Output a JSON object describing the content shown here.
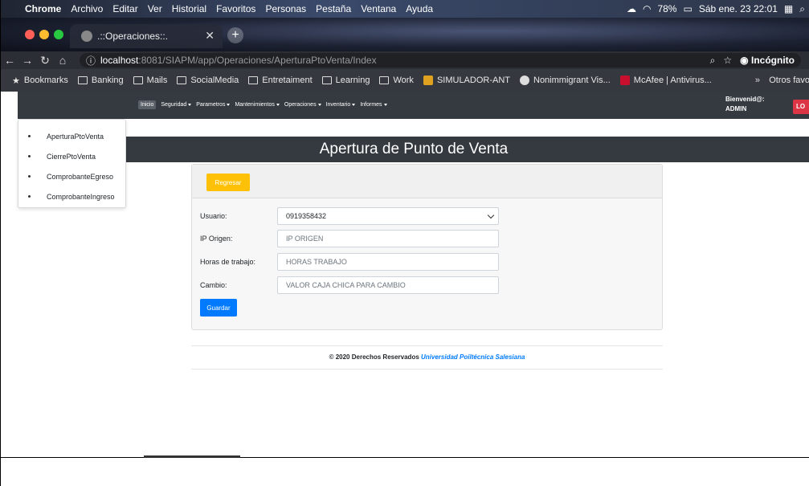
{
  "macbar": {
    "app": "Chrome",
    "menus": [
      "Archivo",
      "Editar",
      "Ver",
      "Historial",
      "Favoritos",
      "Personas",
      "Pestaña",
      "Ventana",
      "Ayuda"
    ],
    "battery": "78%",
    "datetime": "Sáb ene. 23 22:01"
  },
  "tab": {
    "title": ".::Operaciones::.",
    "new_tab": "+"
  },
  "address": {
    "host": "localhost",
    "path": ":8081/SIAPM/app/Operaciones/AperturaPtoVenta/Index",
    "mode": "Incógnito"
  },
  "bookmarks": {
    "items": [
      "Bookmarks",
      "Banking",
      "Mails",
      "SocialMedia",
      "Entretaiment",
      "Learning",
      "Work",
      "SIMULADOR-ANT",
      "Nonimmigrant Vis...",
      "McAfee | Antivirus..."
    ],
    "more": "»",
    "others": "Otros favo"
  },
  "appnav": {
    "home": "Inicio",
    "menus": [
      "Seguridad",
      "Parametros",
      "Mantenimientos",
      "Operaciones",
      "Inventario",
      "Informes"
    ],
    "welcome": "Bienvenid@:",
    "user": "ADMIN",
    "logout": "LO"
  },
  "dropdown": {
    "items": [
      "AperturaPtoVenta",
      "CierrePtoVenta",
      "ComprobanteEgreso",
      "ComprobanteIngreso"
    ]
  },
  "page": {
    "title": "Apertura de Punto de Venta",
    "back_button": "Regresar",
    "save_button": "Guardar"
  },
  "form": {
    "usuario_label": "Usuario:",
    "usuario_value": "0919358432",
    "ip_label": "IP Origen:",
    "ip_placeholder": "IP ORIGEN",
    "horas_label": "Horas de trabajo:",
    "horas_placeholder": "HORAS TRABAJO",
    "cambio_label": "Cambio:",
    "cambio_placeholder": "VALOR CAJA CHICA PARA CAMBIO"
  },
  "footer": {
    "text": "© 2020 Derechos Reservados",
    "university": "Universidad Poiltécnica Salesiana"
  }
}
